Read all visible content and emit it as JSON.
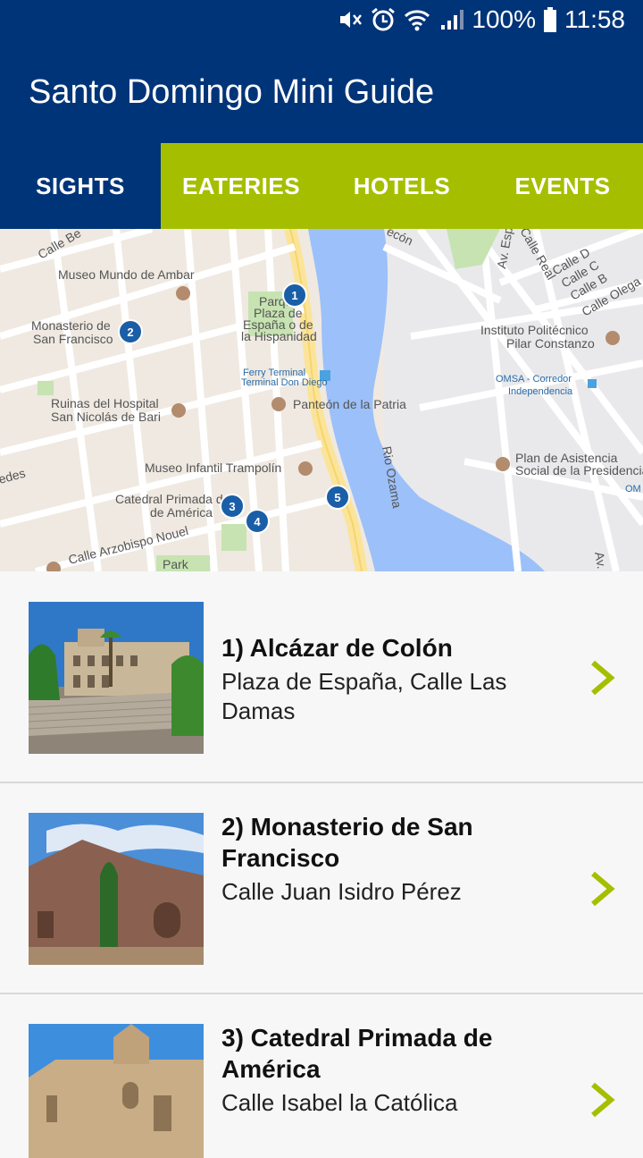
{
  "status": {
    "battery": "100%",
    "time": "11:58"
  },
  "app": {
    "title": "Santo Domingo Mini Guide"
  },
  "tabs": [
    {
      "label": "SIGHTS",
      "active": true
    },
    {
      "label": "EATERIES",
      "active": false
    },
    {
      "label": "HOTELS",
      "active": false
    },
    {
      "label": "EVENTS",
      "active": false
    }
  ],
  "map": {
    "labels": [
      "Museo Mundo de Ambar",
      "Monasterio de",
      "San Francisco",
      "Ruinas del Hospital",
      "San Nicolás de Bari",
      "Museo Infantil Trampolín",
      "Catedral Primada de",
      "de América",
      "Calle Arzobispo Nouel",
      "Parque",
      "Plaza de",
      "España o de",
      "la Hispanidad",
      "Ferry Terminal",
      "Terminal Don Diego",
      "Panteón de la Patria",
      "Rio Ozama",
      "Instituto Politécnico",
      "Pilar Constanzo",
      "OMSA - Corredor",
      "Independencia",
      "Plan de Asistencia",
      "Social de la Presidencia",
      "Calle D",
      "Calle C",
      "Calle B",
      "Calle Olega",
      "Calle Real",
      "Av. Esp",
      "Park",
      "edes",
      "Calle Be",
      "ecón",
      "OM",
      "Av."
    ],
    "markers": [
      "1",
      "2",
      "3",
      "4",
      "5"
    ]
  },
  "sights": [
    {
      "name": "1) Alcázar de Colón",
      "address": "Plaza de España, Calle Las Damas"
    },
    {
      "name": "2) Monasterio de San Francisco",
      "address": "Calle Juan Isidro Pérez"
    },
    {
      "name": "3) Catedral Primada de América",
      "address": "Calle Isabel la Católica"
    }
  ],
  "colors": {
    "primary": "#003478",
    "accent": "#a5bf00",
    "chevron": "#a5bf00"
  }
}
